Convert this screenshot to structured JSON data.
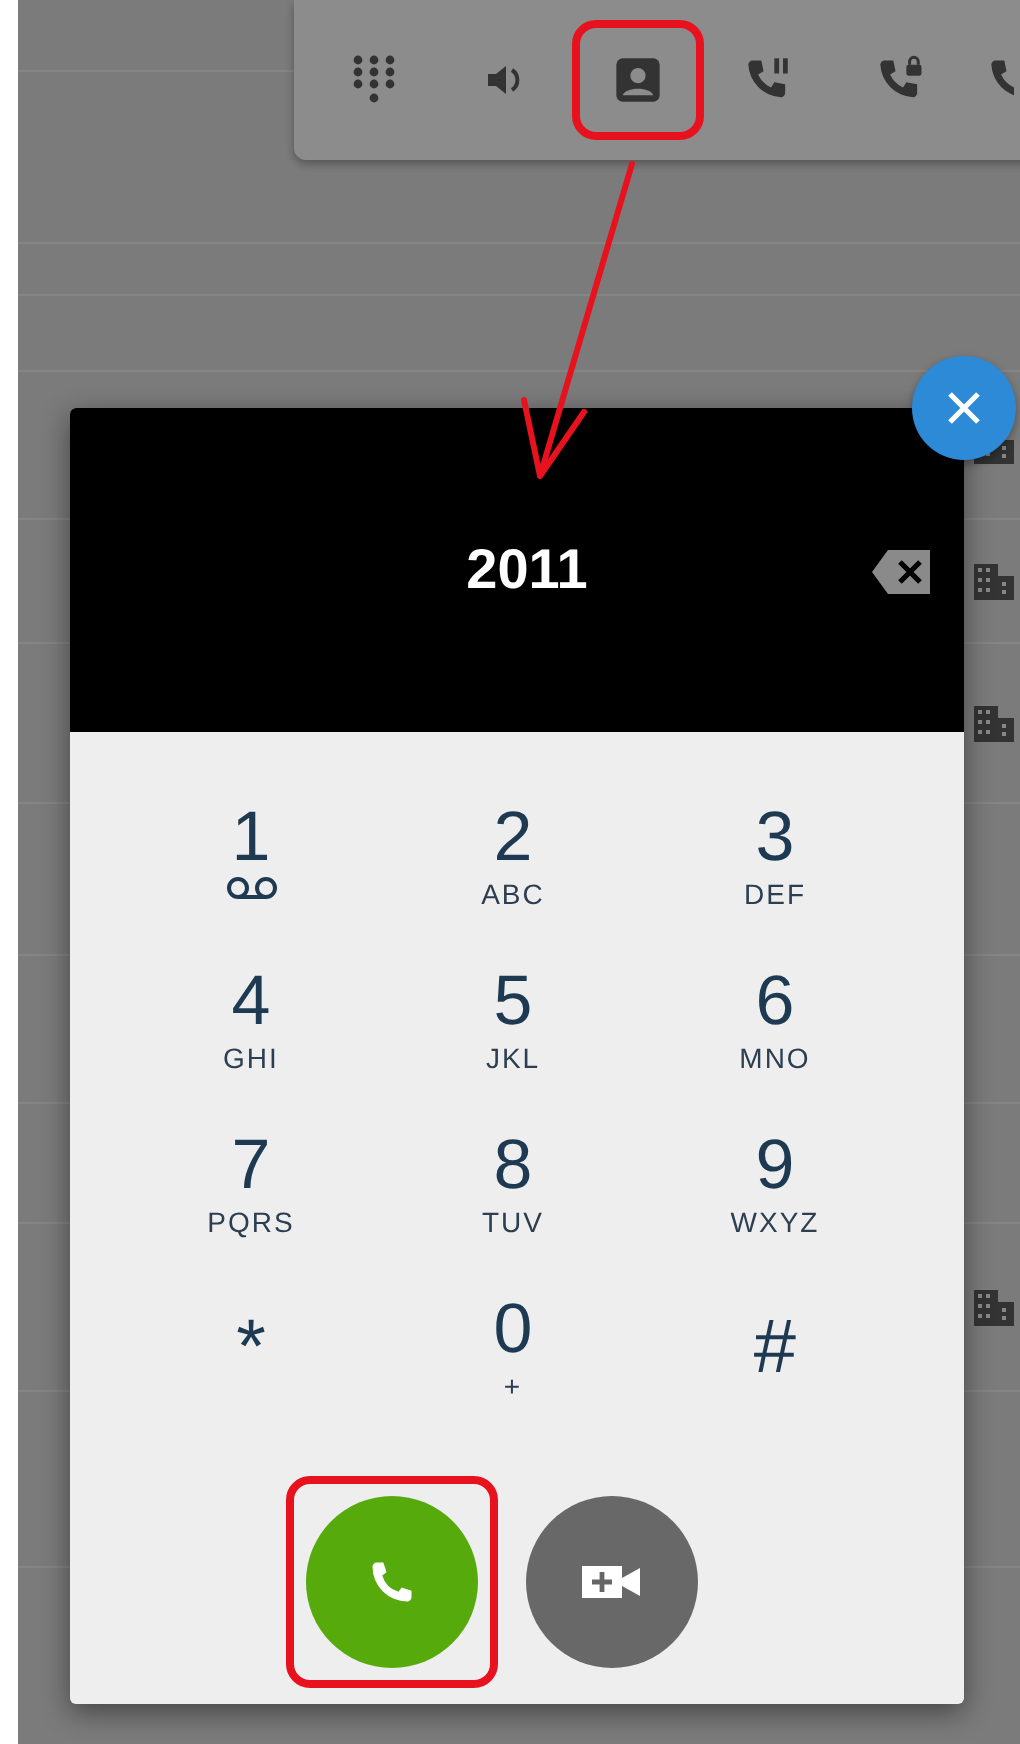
{
  "toolbar": {
    "items": [
      {
        "kind": "dialpad",
        "highlighted": false
      },
      {
        "kind": "speaker",
        "highlighted": false
      },
      {
        "kind": "contacts",
        "highlighted": true
      },
      {
        "kind": "hold",
        "highlighted": false
      },
      {
        "kind": "lock",
        "highlighted": false
      },
      {
        "kind": "phone",
        "highlighted": false
      }
    ]
  },
  "dialer": {
    "number": "2011",
    "keys": [
      {
        "kind": "voicemail",
        "digit": "1"
      },
      {
        "kind": "letters",
        "digit": "2",
        "letters": "ABC"
      },
      {
        "kind": "letters",
        "digit": "3",
        "letters": "DEF"
      },
      {
        "kind": "letters",
        "digit": "4",
        "letters": "GHI"
      },
      {
        "kind": "letters",
        "digit": "5",
        "letters": "JKL"
      },
      {
        "kind": "letters",
        "digit": "6",
        "letters": "MNO"
      },
      {
        "kind": "letters",
        "digit": "7",
        "letters": "PQRS"
      },
      {
        "kind": "letters",
        "digit": "8",
        "letters": "TUV"
      },
      {
        "kind": "letters",
        "digit": "9",
        "letters": "WXYZ"
      },
      {
        "kind": "symbol",
        "digit": "*"
      },
      {
        "kind": "letters",
        "digit": "0",
        "letters": "+"
      },
      {
        "kind": "symbol",
        "digit": "#"
      }
    ],
    "actions": [
      {
        "kind": "call",
        "highlighted": true
      },
      {
        "kind": "video",
        "highlighted": false
      }
    ]
  }
}
